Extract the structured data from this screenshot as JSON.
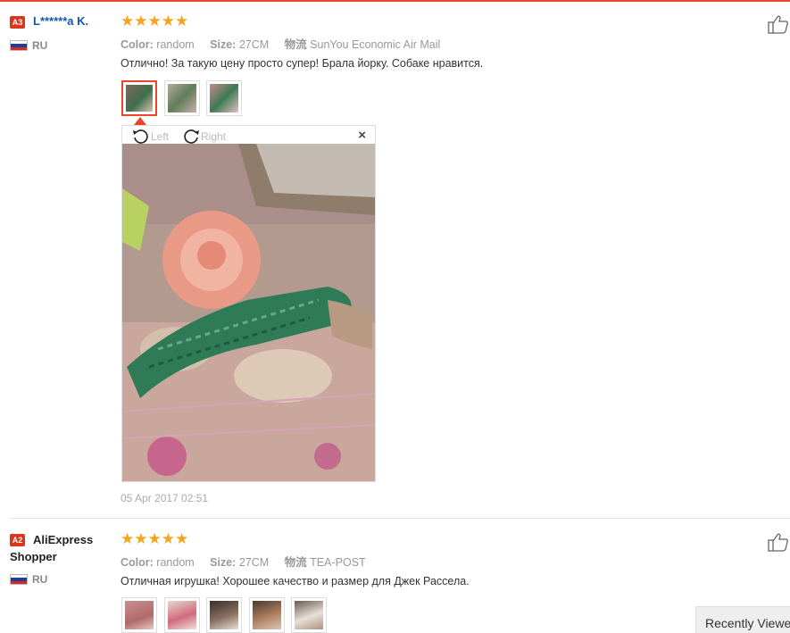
{
  "reviews": [
    {
      "level": "A3",
      "name": "L******a K.",
      "country": "RU",
      "stars": "★★★★★",
      "color_label": "Color:",
      "color_value": "random",
      "size_label": "Size:",
      "size_value": "27CM",
      "logistics_label": "物流",
      "logistics_value": "SunYou Economic Air Mail",
      "text": "Отлично! За такую цену просто супер! Брала йорку. Собаке нравится.",
      "date": "05 Apr 2017 02:51",
      "viewer": {
        "left_label": "Left",
        "right_label": "Right",
        "close": "×"
      }
    },
    {
      "level": "A2",
      "name_line1": "AliExpress",
      "name_line2": "Shopper",
      "country": "RU",
      "stars": "★★★★★",
      "color_label": "Color:",
      "color_value": "random",
      "size_label": "Size:",
      "size_value": "27CM",
      "logistics_label": "物流",
      "logistics_value": "TEA-POST",
      "text": "Отличная игрушка! Хорошее качество и размер для Джек Рассела."
    }
  ],
  "recently_viewed": "Recently Viewed",
  "colors": {
    "accent": "#e8452c",
    "star": "#f5a41d",
    "link": "#0e5aa7"
  },
  "icons": [
    "thumbs-up-icon",
    "rotate-left-icon",
    "rotate-right-icon",
    "close-icon",
    "russia-flag-icon"
  ]
}
